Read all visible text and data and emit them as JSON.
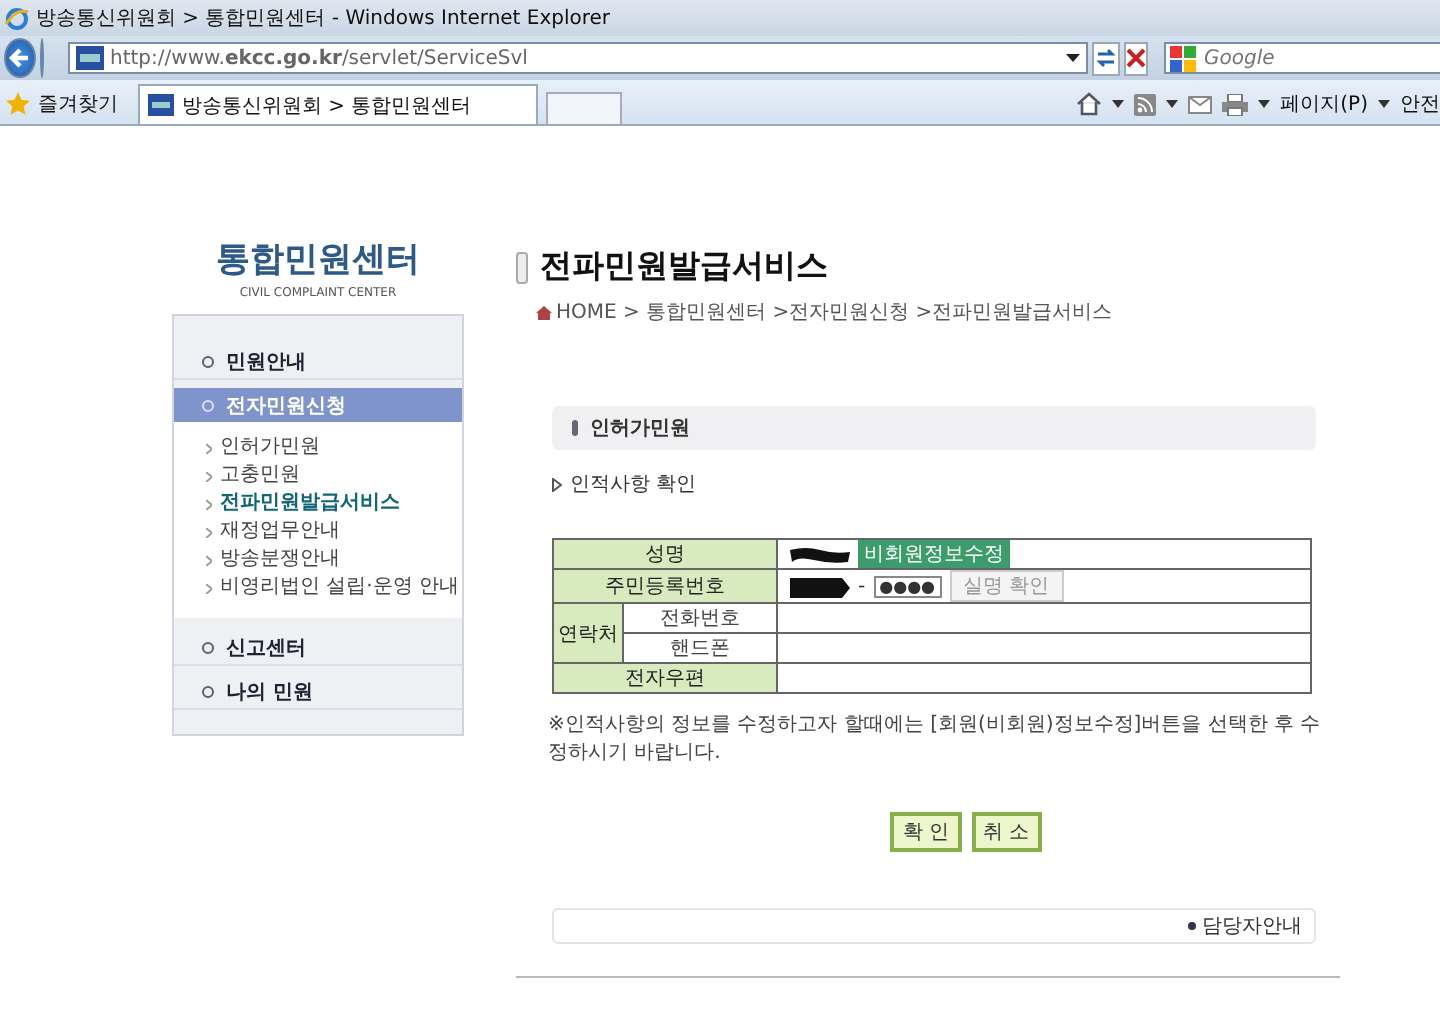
{
  "window": {
    "title": "방송통신위원회 > 통합민원센터 - Windows Internet Explorer"
  },
  "address_bar": {
    "url": "http://www.**ekcc.go.kr**/servlet/ServiceSvl"
  },
  "search": {
    "placeholder": "Google"
  },
  "favorites": {
    "label": "즐겨찾기"
  },
  "tabs": [
    {
      "label": "방송통신위원회 > 통합민원센터",
      "selected": true
    }
  ],
  "command_bar": {
    "page_menu": "페이지(P)",
    "safety_menu": "안전"
  },
  "sidebar": {
    "logo": "통합민원센터",
    "logo_subtitle": "CIVIL COMPLAINT CENTER",
    "items": [
      {
        "label": "민원안내",
        "selected": false
      },
      {
        "label": "전자민원신청",
        "selected": true,
        "children": [
          {
            "label": "인허가민원",
            "selected": false
          },
          {
            "label": "고충민원",
            "selected": false
          },
          {
            "label": "전파민원발급서비스",
            "selected": true
          },
          {
            "label": "재정업무안내",
            "selected": false
          },
          {
            "label": "방송분쟁안내",
            "selected": false
          },
          {
            "label": "비영리법인 설립·운영 안내",
            "selected": false
          }
        ]
      },
      {
        "label": "신고센터",
        "selected": false
      },
      {
        "label": "나의 민원",
        "selected": false
      }
    ]
  },
  "page": {
    "title": "전파민원발급서비스",
    "breadcrumb": "HOME > 통합민원센터 >전자민원신청 >전파민원발급서비스",
    "section": "인허가민원",
    "subsection": "인적사항 확인",
    "form": {
      "name_label": "성명",
      "edit_button": "비회원정보수정",
      "id_label": "주민등록번호",
      "id_dash": "-",
      "id_masked": "●●●●",
      "verify_button": {
        "label": "실명 확인",
        "disabled": true
      },
      "contact_label": "연락처",
      "phone_label": "전화번호",
      "mobile_label": "핸드폰",
      "email_label": "전자우편"
    },
    "note": "※인적사항의 정보를 수정하고자 할때에는 [회원(비회원)정보수정]버튼을 선택한 후 수정하시기 바랍니다.",
    "buttons": [
      "확 인",
      "취 소"
    ],
    "info_link": "담당자안내"
  }
}
